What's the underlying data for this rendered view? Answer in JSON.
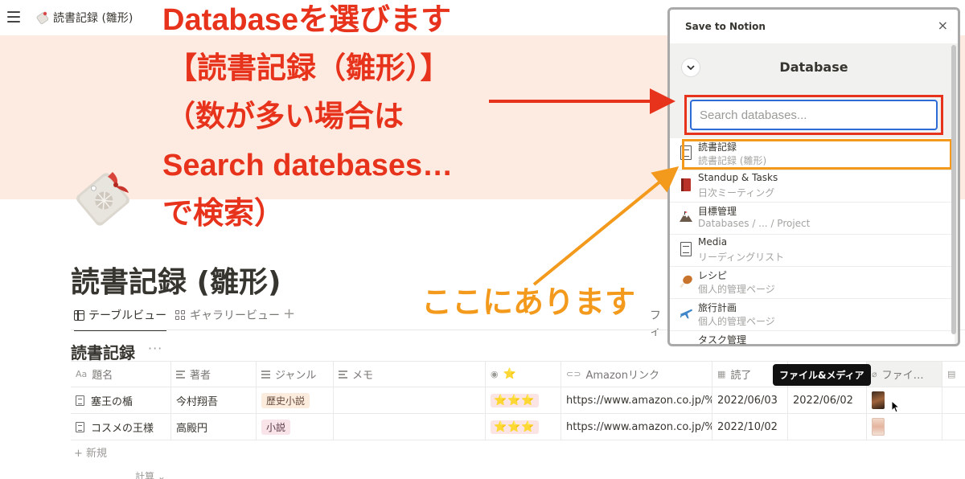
{
  "header": {
    "breadcrumb": "読書記録 (雛形)"
  },
  "annotations": {
    "red_lines": [
      "Databaseを選びます",
      "【読書記録（雛形）】",
      "（数が多い場合は",
      "Search datebases…",
      "で検索）"
    ],
    "orange": "ここにあります",
    "colors": {
      "red": "#e8331c",
      "orange": "#f39a1c"
    }
  },
  "page": {
    "title": "読書記録 (雛形)",
    "tabs": [
      {
        "label": "テーブルビュー",
        "icon": "table-icon"
      },
      {
        "label": "ギャラリービュー",
        "icon": "gallery-icon"
      }
    ],
    "add_view": "+",
    "filter_label": "フィ",
    "db_title": "読書記録",
    "db_more": "···"
  },
  "table": {
    "columns": [
      {
        "label": "題名",
        "icon": "Aa"
      },
      {
        "label": "著者",
        "icon": "text-icon"
      },
      {
        "label": "ジャンル",
        "icon": "list-icon"
      },
      {
        "label": "メモ",
        "icon": "text-icon"
      },
      {
        "label": "⭐",
        "icon": "select-icon"
      },
      {
        "label": "Amazonリンク",
        "icon": "link-icon"
      },
      {
        "label": "読了",
        "icon": "calendar-icon"
      },
      {
        "label": "ファイ…",
        "icon": "attachment-icon"
      }
    ],
    "rows": [
      {
        "title": "塞王の楯",
        "author": "今村翔吾",
        "genre": "歴史小説",
        "memo": "",
        "stars": "⭐⭐⭐",
        "link": "https://www.amazon.co.jp/%E",
        "done": "2022/06/03",
        "date2": "2022/06/02"
      },
      {
        "title": "コスメの王様",
        "author": "高殿円",
        "genre": "小説",
        "memo": "",
        "stars": "⭐⭐⭐",
        "link": "https://www.amazon.co.jp/%E",
        "done": "2022/10/02",
        "date2": ""
      }
    ],
    "tooltip": "ファイル&メディア",
    "new_label": "+ 新規",
    "calc_label": "計算 ⌄"
  },
  "popup": {
    "title": "Save to Notion",
    "close": "×",
    "section": "Database",
    "search_placeholder": "Search databases...",
    "items": [
      {
        "name": "読書記録",
        "sub": "読書記録 (雛形)",
        "icon": "document-icon"
      },
      {
        "name": "Standup & Tasks",
        "sub": "日次ミーティング",
        "icon": "red-book-icon"
      },
      {
        "name": "目標管理",
        "sub": "Databases / ... / Project",
        "icon": "mountain-icon"
      },
      {
        "name": "Media",
        "sub": "リーディングリスト",
        "icon": "document-icon"
      },
      {
        "name": "レシピ",
        "sub": "個人的管理ページ",
        "icon": "chicken-leg-icon"
      },
      {
        "name": "旅行計画",
        "sub": "個人的管理ページ",
        "icon": "airplane-icon"
      },
      {
        "name": "タスク管理",
        "sub": "",
        "icon": "pin-icon"
      }
    ]
  }
}
